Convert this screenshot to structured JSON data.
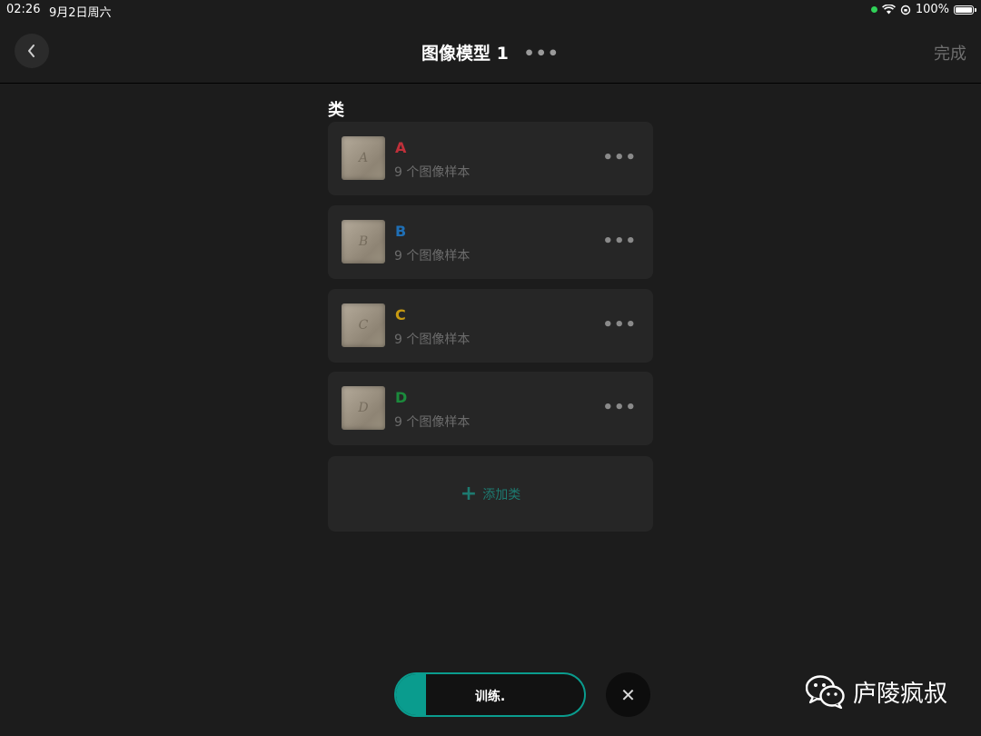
{
  "status": {
    "time": "02:26",
    "date": "9月2日周六",
    "battery": "100%"
  },
  "nav": {
    "title": "图像模型 1",
    "more": "•••",
    "done_label": "完成"
  },
  "section_label": "类",
  "classes": [
    {
      "name": "A",
      "color": "#c0303a",
      "samples": "9 个图像样本",
      "thumb_letter": "A"
    },
    {
      "name": "B",
      "color": "#1f6fb5",
      "samples": "9 个图像样本",
      "thumb_letter": "B"
    },
    {
      "name": "C",
      "color": "#c79a12",
      "samples": "9 个图像样本",
      "thumb_letter": "C"
    },
    {
      "name": "D",
      "color": "#1b8a3c",
      "samples": "9 个图像样本",
      "thumb_letter": "D"
    }
  ],
  "card_more": "•••",
  "add_class": {
    "icon": "+",
    "label": "添加类"
  },
  "train": {
    "label": "训练.",
    "progress": 0.16
  },
  "close_icon": "✕",
  "watermark": {
    "text": "庐陵疯叔",
    "icon": "wechat-icon"
  }
}
